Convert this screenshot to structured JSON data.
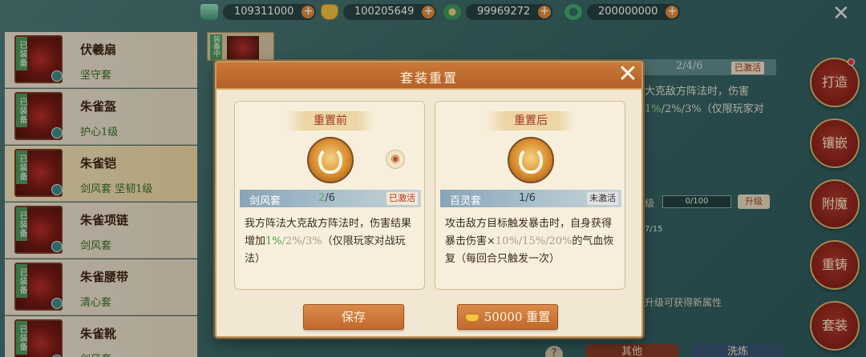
{
  "currencies": [
    {
      "icon": "jade-tower-icon",
      "value": "109311000"
    },
    {
      "icon": "gold-ingot-icon",
      "value": "100205649"
    },
    {
      "icon": "green-coin-icon",
      "value": "99969272"
    },
    {
      "icon": "jade-ring-icon",
      "value": "200000000"
    }
  ],
  "equipment": [
    {
      "tag": "已装备",
      "name": "伏羲扇",
      "sub": "坚守套"
    },
    {
      "tag": "已装备",
      "name": "朱雀盔",
      "sub": "护心1级"
    },
    {
      "tag": "已装备",
      "name": "朱雀铠",
      "sub": "剑风套  坚韧1级"
    },
    {
      "tag": "已装备",
      "name": "朱雀项链",
      "sub": "剑风套"
    },
    {
      "tag": "已装备",
      "name": "朱雀腰带",
      "sub": "清心套"
    },
    {
      "tag": "已装备",
      "name": "朱雀靴",
      "sub": "剑风套"
    }
  ],
  "second_thumb_tag": "装备中",
  "right_panel": {
    "count": "2/4/6",
    "status": "已激活",
    "line1": "大克敌方阵法时，伤害",
    "line2_green": "1%",
    "line2_rest": "/2%/3%（仅限玩家对",
    "level_label": "级",
    "progress": "0/100",
    "upgrade": "升级",
    "frac": "7/15",
    "hint": "升级可获得新属性"
  },
  "side_buttons": [
    "打造",
    "镶嵌",
    "附魔",
    "重铸",
    "套装"
  ],
  "bottom_tabs": [
    "其他",
    "洗炼"
  ],
  "modal": {
    "title": "套装重置",
    "before": {
      "label": "重置前",
      "set_name": "剑风套",
      "count_green": "2",
      "count_rest": "/6",
      "status": "已激活",
      "desc_a": "我方阵法大克敌方阵法时，伤害结果增加",
      "desc_green": "1%",
      "desc_gray": "/2%/3%",
      "desc_b": "（仅限玩家对战玩法）"
    },
    "after": {
      "label": "重置后",
      "set_name": "百灵套",
      "count": "1/6",
      "status": "未激活",
      "desc_a": "攻击敌方目标触发暴击时，自身获得暴击伤害×",
      "desc_gray": "10%/15%/20%",
      "desc_b": "的气血恢复（每回合只触发一次）"
    },
    "save_label": "保存",
    "reset_cost": "50000",
    "reset_label": "重置"
  }
}
